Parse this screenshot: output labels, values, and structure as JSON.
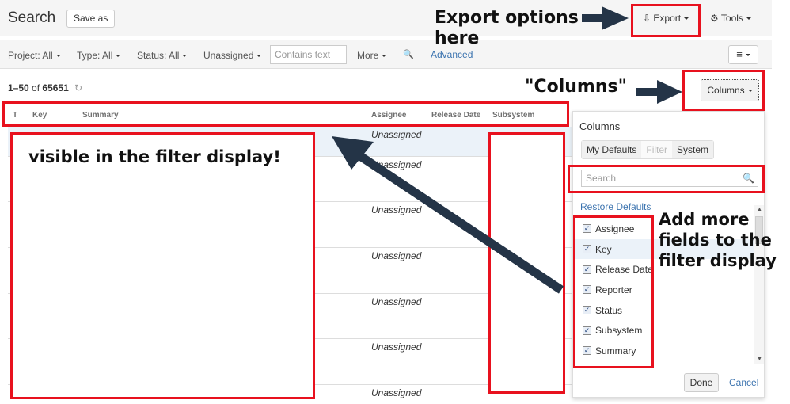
{
  "header": {
    "title": "Search",
    "save_as": "Save as",
    "export": "Export",
    "tools": "Tools"
  },
  "filters": {
    "project": "Project: All",
    "type": "Type: All",
    "status": "Status: All",
    "assignee": "Unassigned",
    "contains_placeholder": "Contains text",
    "more": "More",
    "advanced": "Advanced"
  },
  "results": {
    "range": "1–50",
    "of_label": "of",
    "total": "65651"
  },
  "columns_button": "Columns",
  "table": {
    "headers": [
      "T",
      "Key",
      "Summary",
      "Assignee",
      "Release Date",
      "Subsystem"
    ],
    "rows": [
      {
        "assignee": "Unassigned"
      },
      {
        "assignee": "Unassigned"
      },
      {
        "assignee": "Unassigned"
      },
      {
        "assignee": "Unassigned"
      },
      {
        "assignee": "Unassigned"
      },
      {
        "assignee": "Unassigned"
      },
      {
        "assignee": "Unassigned"
      }
    ]
  },
  "columns_panel": {
    "title": "Columns",
    "tabs": [
      "My Defaults",
      "Filter",
      "System"
    ],
    "search_placeholder": "Search",
    "restore": "Restore Defaults",
    "items": [
      {
        "label": "Assignee",
        "checked": true
      },
      {
        "label": "Key",
        "checked": true
      },
      {
        "label": "Release Date",
        "checked": true
      },
      {
        "label": "Reporter",
        "checked": true
      },
      {
        "label": "Status",
        "checked": true
      },
      {
        "label": "Subsystem",
        "checked": true
      },
      {
        "label": "Summary",
        "checked": true
      }
    ],
    "done": "Done",
    "cancel": "Cancel"
  },
  "annotations": {
    "export": "Export options here",
    "columns": "\"Columns\"",
    "visible": "visible in the filter display!",
    "add_more": "Add more fields to the filter display"
  },
  "colors": {
    "annotation_red": "#e8111e",
    "arrow": "#243447",
    "link": "#3b73af"
  }
}
